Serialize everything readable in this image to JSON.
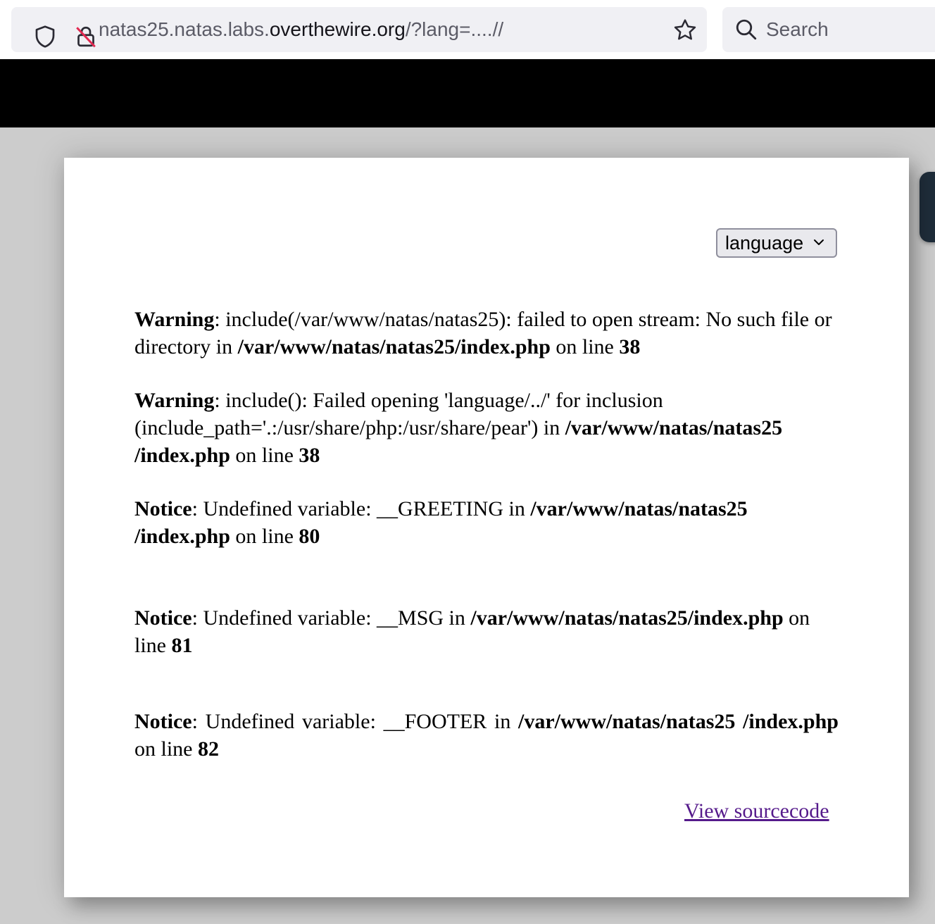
{
  "browser": {
    "url_prefix": "natas25.natas.labs.",
    "url_domain": "overthewire.org",
    "url_path": "/?lang=....//",
    "search_placeholder": "Search"
  },
  "page": {
    "language_select": {
      "selected": "language"
    },
    "messages": [
      {
        "level": "Warning",
        "text": ": include(/var/www/natas/natas25): failed to open stream: No such file or directory in ",
        "file": "/var/www/natas/natas25/index.php",
        "line_label": " on line ",
        "line": "38"
      },
      {
        "level": "Warning",
        "text": ": include(): Failed opening 'language/../' for inclusion (include_path='.:/usr/share/php:/usr/share/pear') in ",
        "file": "/var/www/natas/natas25 /index.php",
        "line_label": " on line ",
        "line": "38"
      },
      {
        "level": "Notice",
        "text": ": Undefined variable: __GREETING in ",
        "file": "/var/www/natas/natas25 /index.php",
        "line_label": " on line ",
        "line": "80"
      },
      {
        "level": "Notice",
        "text": ": Undefined variable: __MSG in ",
        "file": "/var/www/natas/natas25/index.php",
        "line_label": " on line ",
        "line": "81"
      },
      {
        "level": "Notice",
        "text": ": Undefined variable: __FOOTER in ",
        "file": "/var/www/natas/natas25 /index.php",
        "line_label": " on line ",
        "line": "82"
      }
    ],
    "source_link": "View sourcecode"
  },
  "colors": {
    "header_band": "#000000",
    "page_background": "#cccccc",
    "visited_link": "#551a8b"
  }
}
